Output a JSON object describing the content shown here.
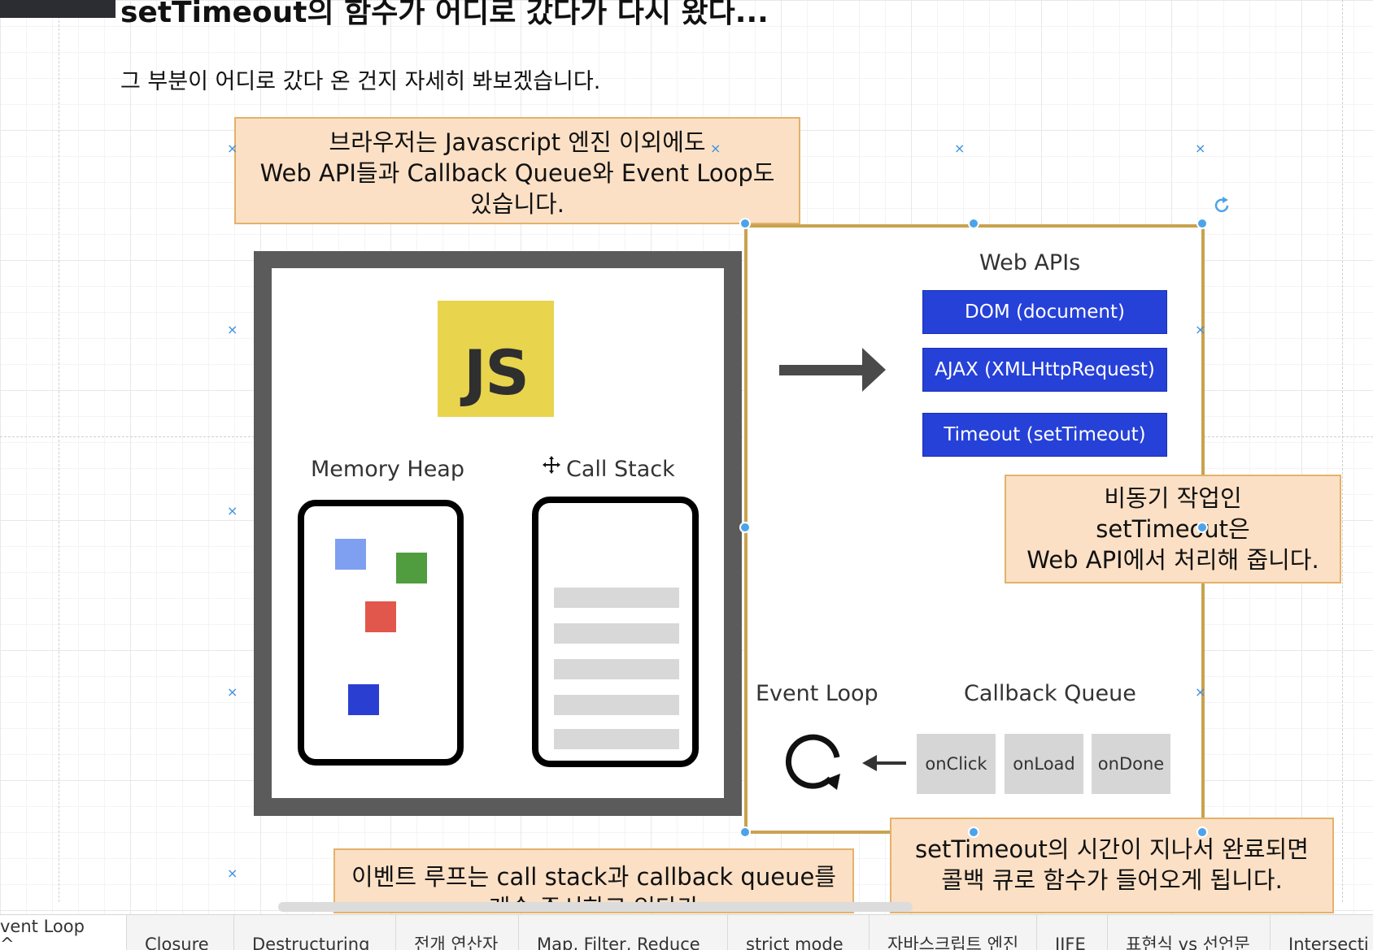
{
  "page": {
    "title": "setTimeout의 함수가 어디로 갔다가 다시 왔다...",
    "subtitle": "그 부분이 어디로 갔다 온 건지 자세히 봐보겠습니다."
  },
  "notes": {
    "browser": [
      "브라우저는 Javascript 엔진 이외에도",
      "Web API들과 Callback Queue와 Event Loop도",
      "있습니다."
    ],
    "async": [
      "비동기 작업인",
      "setTimeout은",
      "Web API에서 처리해 줍니다."
    ],
    "event_loop": [
      "이벤트 루프는 call stack과 callback queue를",
      "계속 주시하고 있다가"
    ],
    "timeout_done": [
      "setTimeout의 시간이 지나서 완료되면",
      "콜백 큐로 함수가 들어오게 됩니다."
    ]
  },
  "engine": {
    "logo_text": "JS",
    "memory_heap_label": "Memory Heap",
    "call_stack_label": "Call Stack",
    "heap_colors": [
      "#7f9ff0",
      "#4f9d3f",
      "#e2574c",
      "#2a3fd2"
    ]
  },
  "web_apis": {
    "title": "Web APIs",
    "items": [
      "DOM (document)",
      "AJAX (XMLHttpRequest)",
      "Timeout (setTimeout)"
    ],
    "color": "#2641d8"
  },
  "event_loop_label": "Event Loop",
  "callback_queue": {
    "label": "Callback Queue",
    "items": [
      "onClick",
      "onLoad",
      "onDone"
    ]
  },
  "tabs": [
    {
      "label": "vent Loop",
      "active": true,
      "chevron": "^"
    },
    {
      "label": "Closure"
    },
    {
      "label": "Destructuring"
    },
    {
      "label": "전개 연산자"
    },
    {
      "label": "Map, Filter, Reduce"
    },
    {
      "label": "strict mode"
    },
    {
      "label": "자바스크립트 엔진"
    },
    {
      "label": "IIFE"
    },
    {
      "label": "표현식 vs 선언문"
    },
    {
      "label": "Intersecti"
    }
  ],
  "colors": {
    "note_fill": "#fbe0c5",
    "note_border": "#e3b26a",
    "selection_border": "#c9a24f",
    "handle": "#4da3ea",
    "js_yellow": "#e8d44d"
  }
}
